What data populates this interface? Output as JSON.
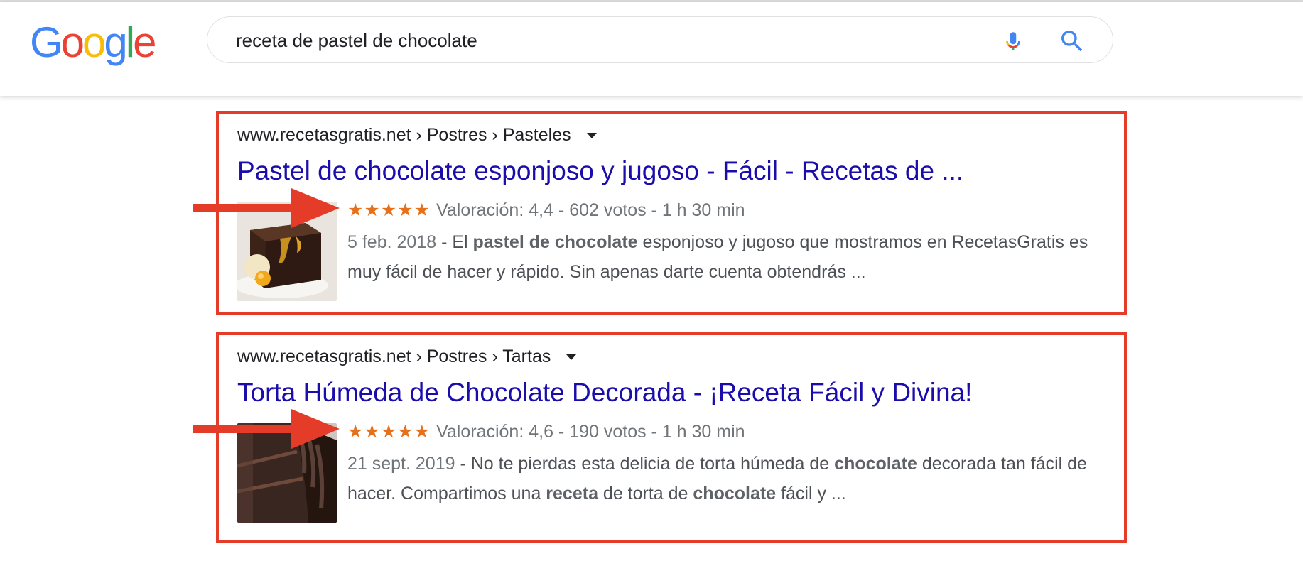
{
  "search": {
    "query": "receta de pastel de chocolate",
    "logo_letters": [
      "G",
      "o",
      "o",
      "g",
      "l",
      "e"
    ],
    "logo_colors": [
      "#4285F4",
      "#EA4335",
      "#FBBC05",
      "#4285F4",
      "#34A853",
      "#EA4335"
    ]
  },
  "results": [
    {
      "breadcrumb": "www.recetasgratis.net › Postres › Pasteles",
      "title": "Pastel de chocolate esponjoso y jugoso - Fácil - Recetas de ...",
      "stars": "★★★★★",
      "rating": 4.4,
      "rating_text": "Valoración: 4,4 - 602 votos - 1 h 30 min",
      "date": "5 feb. 2018",
      "snippet": [
        {
          "t": " - El ",
          "b": false
        },
        {
          "t": "pastel de chocolate",
          "b": true
        },
        {
          "t": " esponjoso y jugoso que mostramos en RecetasGratis es muy fácil de hacer y rápido. Sin apenas darte cuenta obtendrás ...",
          "b": false
        }
      ]
    },
    {
      "breadcrumb": "www.recetasgratis.net › Postres › Tartas",
      "title": "Torta Húmeda de Chocolate Decorada - ¡Receta Fácil y Divina!",
      "stars": "★★★★★",
      "rating": 4.6,
      "rating_text": "Valoración: 4,6 - 190 votos - 1 h 30 min",
      "date": "21 sept. 2019",
      "snippet": [
        {
          "t": " - No te pierdas esta delicia de torta húmeda de ",
          "b": false
        },
        {
          "t": "chocolate",
          "b": true
        },
        {
          "t": " decorada tan fácil de hacer. Compartimos una ",
          "b": false
        },
        {
          "t": "receta",
          "b": true
        },
        {
          "t": " de torta de ",
          "b": false
        },
        {
          "t": "chocolate",
          "b": true
        },
        {
          "t": " fácil y ...",
          "b": false
        }
      ]
    }
  ],
  "icons": {
    "mic": "microphone-icon",
    "search": "search-icon",
    "caret": "caret-down-icon",
    "arrow": "red-arrow-icon"
  },
  "colors": {
    "highlight_border": "#e53c2a",
    "link": "#1a0dab",
    "stars": "#e7711b"
  }
}
